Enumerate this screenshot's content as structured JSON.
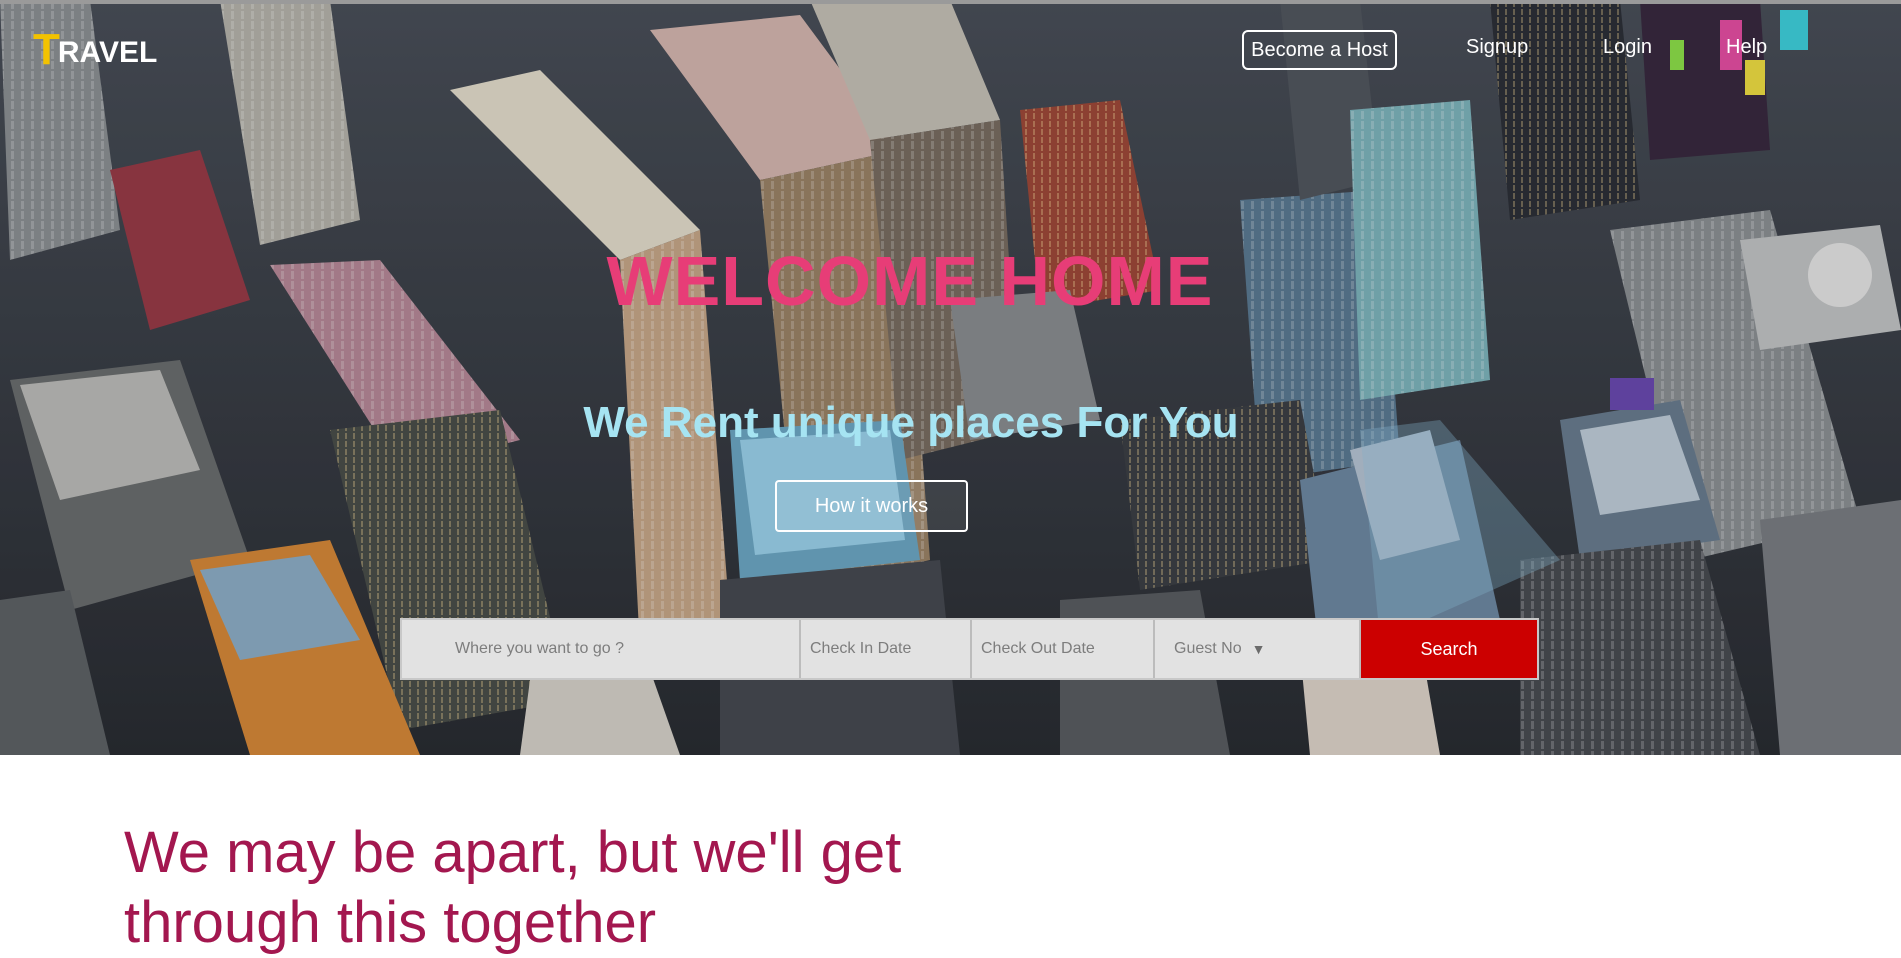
{
  "brand": {
    "initial": "T",
    "rest": "RAVEL",
    "initial_color": "#f2c200"
  },
  "nav": {
    "host_label": "Become a Host",
    "signup_label": "Signup",
    "login_label": "Login",
    "help_label": "Help"
  },
  "hero": {
    "title": "WELCOME HOME",
    "subtitle": "We Rent unique places For You",
    "how_it_works_label": "How it works",
    "title_color": "#e73d77",
    "subtitle_color": "#a6e4f2",
    "background": "aerial-city-skyline"
  },
  "search": {
    "where_placeholder": "Where you want to go ?",
    "check_in_placeholder": "Check In Date",
    "check_out_placeholder": "Check Out Date",
    "guest_label": "Guest No",
    "guest_caret": "▼",
    "search_label": "Search",
    "search_color": "#cc0000"
  },
  "section": {
    "headline": "We may be apart, but we'll get through this together",
    "headline_color": "#a3174f"
  }
}
